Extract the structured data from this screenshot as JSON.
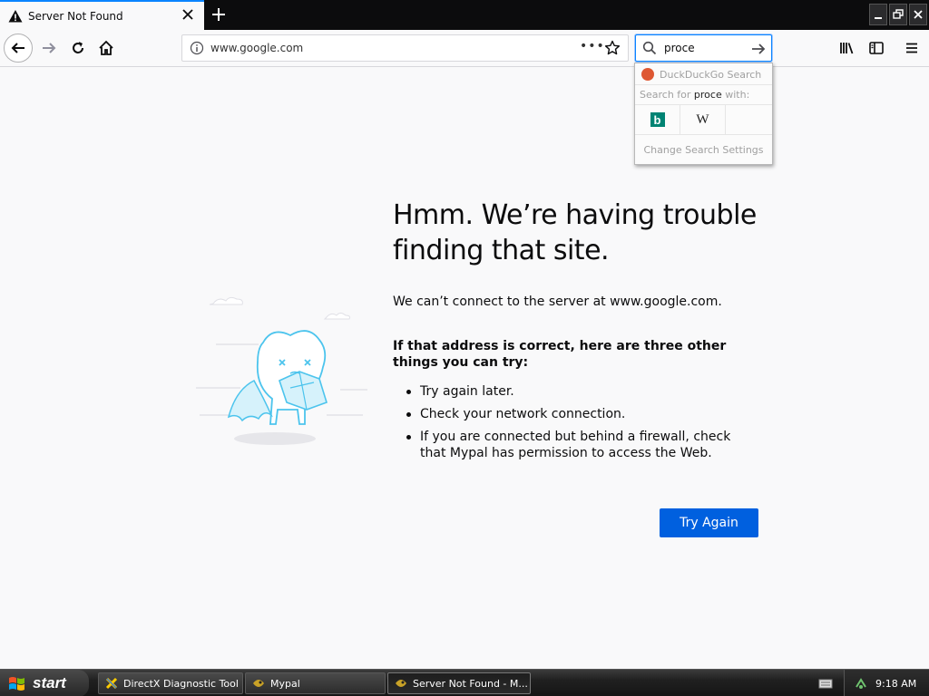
{
  "tab": {
    "title": "Server Not Found",
    "icon": "warning-icon"
  },
  "navbar": {
    "url": "www.google.com",
    "search_value": "proce"
  },
  "search_popup": {
    "engine_name": "DuckDuckGo Search",
    "search_for_prefix": "Search for ",
    "search_term": "proce",
    "search_for_suffix": " with:",
    "engines": [
      "bing-icon",
      "wikipedia-icon"
    ],
    "bing_glyph": "b",
    "wiki_glyph": "W",
    "settings_label": "Change Search Settings"
  },
  "error": {
    "title": "Hmm. We’re having trouble finding that site.",
    "message": "We can’t connect to the server at www.google.com.",
    "subhead": "If that address is correct, here are three other things you can try:",
    "tips": [
      "Try again later.",
      "Check your network connection.",
      "If you are connected but behind a firewall, check that Mypal has permission to access the Web."
    ],
    "button_label": "Try Again"
  },
  "taskbar": {
    "start_label": "start",
    "tasks": [
      {
        "label": "DirectX Diagnostic Tool"
      },
      {
        "label": "Mypal"
      },
      {
        "label": "Server Not Found - M..."
      }
    ],
    "clock": "9:18 AM"
  },
  "colors": {
    "accent": "#0a84ff",
    "button": "#0060df",
    "illustration": "#4cc4ed"
  }
}
